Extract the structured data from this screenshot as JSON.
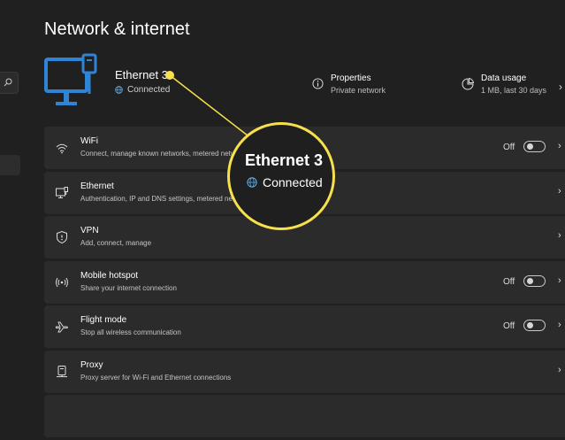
{
  "page_title": "Network & internet",
  "header": {
    "name": "Ethernet 3",
    "status": "Connected",
    "properties": {
      "title": "Properties",
      "subtitle": "Private network"
    },
    "data_usage": {
      "title": "Data usage",
      "subtitle": "1 MB, last 30 days"
    },
    "chevron": "›"
  },
  "rows": [
    {
      "title": "WiFi",
      "subtitle": "Connect, manage known networks, metered network",
      "icon": "wifi-icon",
      "toggle": "Off",
      "chevron": "›"
    },
    {
      "title": "Ethernet",
      "subtitle": "Authentication, IP and DNS settings, metered network",
      "icon": "ethernet-icon",
      "chevron": "›"
    },
    {
      "title": "VPN",
      "subtitle": "Add, connect, manage",
      "icon": "shield-icon",
      "chevron": "›"
    },
    {
      "title": "Mobile hotspot",
      "subtitle": "Share your internet connection",
      "icon": "hotspot-icon",
      "toggle": "Off",
      "chevron": "›"
    },
    {
      "title": "Flight mode",
      "subtitle": "Stop all wireless communication",
      "icon": "airplane-icon",
      "toggle": "Off",
      "chevron": "›"
    },
    {
      "title": "Proxy",
      "subtitle": "Proxy server for Wi-Fi and Ethernet connections",
      "icon": "proxy-icon",
      "chevron": "›"
    }
  ],
  "callout": {
    "name": "Ethernet 3",
    "status": "Connected"
  },
  "colors": {
    "accent": "#2f84d6",
    "highlight": "#f7e04d",
    "status_globe": "#5aa9e6"
  }
}
